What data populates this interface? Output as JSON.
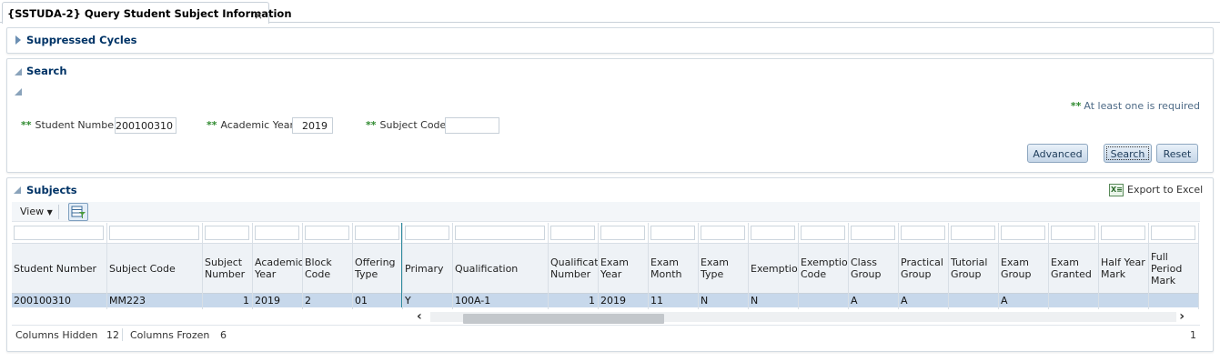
{
  "tab": {
    "title": "{SSTUDA-2} Query Student Subject Information",
    "close": "×"
  },
  "suppressed": {
    "title": "Suppressed Cycles"
  },
  "search": {
    "title": "Search",
    "required_hint_marker": "**",
    "required_hint": "At least one is required",
    "fields": [
      {
        "marker": "**",
        "label": "Student Number",
        "value": "200100310"
      },
      {
        "marker": "**",
        "label": "Academic Year",
        "value": "2019"
      },
      {
        "marker": "**",
        "label": "Subject Code",
        "value": ""
      }
    ],
    "buttons": {
      "advanced": "Advanced",
      "search": "Search",
      "reset": "Reset"
    }
  },
  "subjects": {
    "title": "Subjects",
    "export": "Export to Excel",
    "view_menu": "View",
    "columns": [
      {
        "header": "Student Number",
        "value": "200100310",
        "align": "left"
      },
      {
        "header": "Subject Code",
        "value": "MM223",
        "align": "left"
      },
      {
        "header": "Subject\nNumber",
        "value": "1",
        "align": "right"
      },
      {
        "header": "Academic\nYear",
        "value": "2019",
        "align": "left"
      },
      {
        "header": "Block\nCode",
        "value": "2",
        "align": "left"
      },
      {
        "header": "Offering\nType",
        "value": "01",
        "align": "left"
      },
      {
        "header": "Primary",
        "value": "Y",
        "align": "left"
      },
      {
        "header": "Qualification",
        "value": "100A-1",
        "align": "left"
      },
      {
        "header": "Qualificatic\nNumber",
        "value": "1",
        "align": "right"
      },
      {
        "header": "Exam\nYear",
        "value": "2019",
        "align": "left"
      },
      {
        "header": "Exam\nMonth",
        "value": "11",
        "align": "left"
      },
      {
        "header": "Exam\nType",
        "value": "N",
        "align": "left"
      },
      {
        "header": "Exemption",
        "value": "N",
        "align": "left"
      },
      {
        "header": "Exemption\nCode",
        "value": "",
        "align": "left"
      },
      {
        "header": "Class\nGroup",
        "value": "A",
        "align": "left"
      },
      {
        "header": "Practical\nGroup",
        "value": "A",
        "align": "left"
      },
      {
        "header": "Tutorial\nGroup",
        "value": "",
        "align": "left"
      },
      {
        "header": "Exam\nGroup",
        "value": "A",
        "align": "left"
      },
      {
        "header": "Exam\nGranted",
        "value": "",
        "align": "left"
      },
      {
        "header": "Half Year\nMark",
        "value": "",
        "align": "left"
      },
      {
        "header": "Full\nPeriod\nMark",
        "value": "",
        "align": "left"
      }
    ],
    "footer": {
      "hidden_label": "Columns Hidden",
      "hidden_value": "12",
      "frozen_label": "Columns Frozen",
      "frozen_value": "6",
      "page": "1"
    }
  },
  "colors": {
    "accent": "#003366",
    "selected_row": "#c7d8eb",
    "required": "#2f8a2f"
  }
}
